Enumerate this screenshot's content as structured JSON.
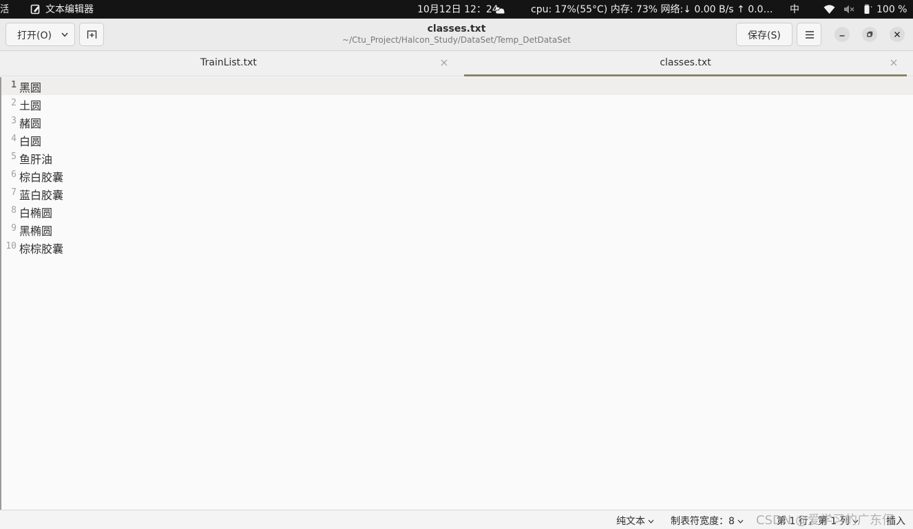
{
  "system_bar": {
    "activities": "活动",
    "app_name": "文本编辑器",
    "clock": "10月12日  12：24",
    "stats": "cpu: 17%(55°C) 内存: 73% 网络:↓  0.00 B/s ↑  0.0…",
    "input_method": "中",
    "battery": "100 %"
  },
  "header": {
    "open_label": "打开(O)",
    "title": "classes.txt",
    "path": "~/Ctu_Project/Halcon_Study/DataSet/Temp_DetDataSet",
    "save_label": "保存(S)"
  },
  "tabs": [
    {
      "label": "TrainList.txt",
      "active": false
    },
    {
      "label": "classes.txt",
      "active": true
    }
  ],
  "editor": {
    "lines": [
      {
        "num": "1",
        "text": "黑圆"
      },
      {
        "num": "2",
        "text": "土圆"
      },
      {
        "num": "3",
        "text": "赭圆"
      },
      {
        "num": "4",
        "text": "白圆"
      },
      {
        "num": "5",
        "text": "鱼肝油"
      },
      {
        "num": "6",
        "text": "棕白胶囊"
      },
      {
        "num": "7",
        "text": "蓝白胶囊"
      },
      {
        "num": "8",
        "text": "白椭圆"
      },
      {
        "num": "9",
        "text": "黑椭圆"
      },
      {
        "num": "10",
        "text": "棕棕胶囊"
      }
    ],
    "current_line": 1
  },
  "status_bar": {
    "language": "纯文本",
    "tab_width": "制表符宽度：8",
    "position": "第 1 行，第 1 列",
    "mode": "插入",
    "watermark": "CSDN @爱学习的广东仔"
  },
  "icons": {
    "app": "text-editor-icon",
    "weather": "weather-icon",
    "wifi": "wifi-icon",
    "volume": "volume-muted-icon",
    "battery": "battery-icon"
  },
  "colors": {
    "topbar_bg": "#141414",
    "active_tab_underline": "#8a8466",
    "current_line_bg": "#f0eeec"
  }
}
